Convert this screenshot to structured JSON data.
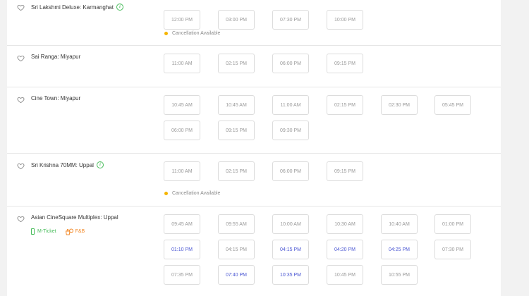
{
  "colors": {
    "accent_green": "#4abd5d",
    "fast_filling_blue": "#4b57d3",
    "available_grey": "#9a9a9a",
    "cancellation_dot": "#f5b400",
    "fnb_orange": "#f28b2c"
  },
  "venues": [
    {
      "name": "Sri Lakshmi Deluxe: Karmanghat",
      "has_info": true,
      "info_icon": "info-icon",
      "rows": [
        [
          {
            "t": "12:00 PM"
          },
          {
            "t": "03:00 PM"
          },
          {
            "t": "07:30 PM"
          },
          {
            "t": "10:00 PM"
          }
        ]
      ],
      "cancellation": "Cancellation Available"
    },
    {
      "name": "Sai Ranga: Miyapur",
      "rows": [
        [
          {
            "t": "11:00 AM"
          },
          {
            "t": "02:15 PM"
          },
          {
            "t": "06:00 PM"
          },
          {
            "t": "09:15 PM"
          }
        ]
      ]
    },
    {
      "name": "Cine Town: Miyapur",
      "rows": [
        [
          {
            "t": "10:45 AM"
          },
          {
            "t": "10:45 AM"
          },
          {
            "t": "11:00 AM"
          },
          {
            "t": "02:15 PM"
          },
          {
            "t": "02:30 PM"
          },
          {
            "t": "05:45 PM"
          }
        ],
        [
          {
            "t": "06:00 PM"
          },
          {
            "t": "09:15 PM"
          },
          {
            "t": "09:30 PM"
          }
        ]
      ]
    },
    {
      "name": "Sri Krishna 70MM: Uppal",
      "has_info": true,
      "info_icon": "info-icon",
      "rows": [
        [
          {
            "t": "11:00 AM"
          },
          {
            "t": "02:15 PM"
          },
          {
            "t": "06:00 PM"
          },
          {
            "t": "09:15 PM"
          }
        ]
      ],
      "cancellation": "Cancellation Available"
    },
    {
      "name": "Asian CineSquare Multiplex: Uppal",
      "features": {
        "mticket": "M-Ticket",
        "fnb": "F&B"
      },
      "rows": [
        [
          {
            "t": "09:45 AM"
          },
          {
            "t": "09:55 AM"
          },
          {
            "t": "10:00 AM"
          },
          {
            "t": "10:30 AM"
          },
          {
            "t": "10:40 AM"
          },
          {
            "t": "01:00 PM"
          }
        ],
        [
          {
            "t": "01:10 PM",
            "fast": true
          },
          {
            "t": "04:15 PM"
          },
          {
            "t": "04:15 PM",
            "fast": true
          },
          {
            "t": "04:20 PM",
            "fast": true
          },
          {
            "t": "04:25 PM",
            "fast": true
          },
          {
            "t": "07:30 PM"
          }
        ],
        [
          {
            "t": "07:35 PM"
          },
          {
            "t": "07:40 PM",
            "fast": true
          },
          {
            "t": "10:35 PM",
            "fast": true
          },
          {
            "t": "10:45 PM"
          },
          {
            "t": "10:55 PM"
          }
        ]
      ]
    }
  ]
}
